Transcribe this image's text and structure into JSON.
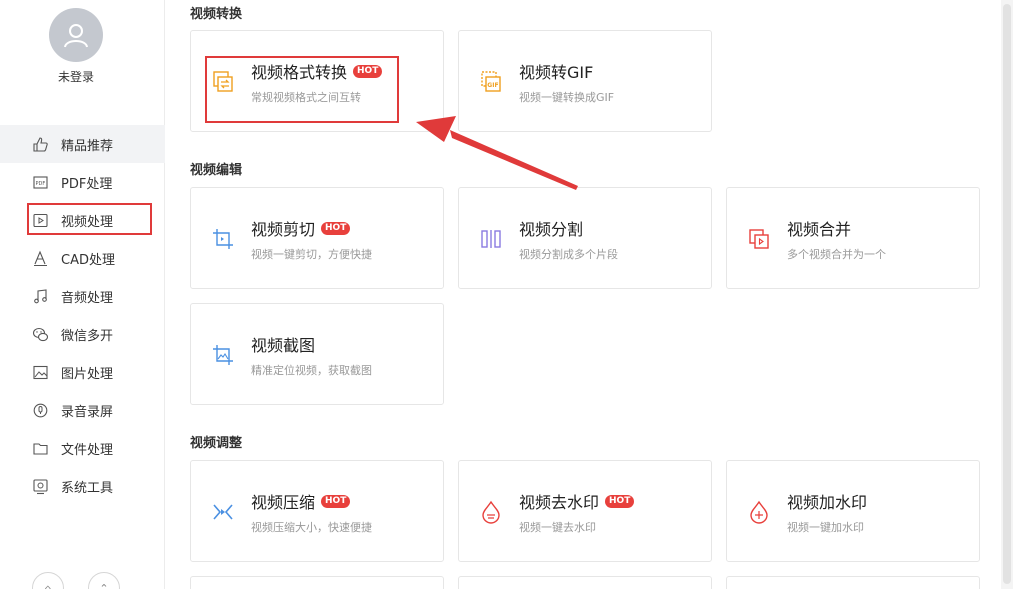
{
  "user": {
    "name": "未登录"
  },
  "sidebar": {
    "items": [
      {
        "label": "精品推荐",
        "icon": "thumbs-up-icon"
      },
      {
        "label": "PDF处理",
        "icon": "pdf-icon"
      },
      {
        "label": "视频处理",
        "icon": "video-icon"
      },
      {
        "label": "CAD处理",
        "icon": "cad-icon"
      },
      {
        "label": "音频处理",
        "icon": "music-note-icon"
      },
      {
        "label": "微信多开",
        "icon": "wechat-icon"
      },
      {
        "label": "图片处理",
        "icon": "image-icon"
      },
      {
        "label": "录音录屏",
        "icon": "record-icon"
      },
      {
        "label": "文件处理",
        "icon": "folder-icon"
      },
      {
        "label": "系统工具",
        "icon": "system-tool-icon"
      }
    ],
    "active_index": 0,
    "highlighted_index": 2
  },
  "sections": [
    {
      "title": "视频转换",
      "cards": [
        {
          "title": "视频格式转换",
          "desc": "常规视频格式之间互转",
          "hot": "HOT",
          "icon": "format-convert-icon"
        },
        {
          "title": "视频转GIF",
          "desc": "视频一键转换成GIF",
          "icon": "gif-icon"
        }
      ]
    },
    {
      "title": "视频编辑",
      "cards": [
        {
          "title": "视频剪切",
          "desc": "视频一键剪切，方便快捷",
          "hot": "HOT",
          "icon": "crop-icon"
        },
        {
          "title": "视频分割",
          "desc": "视频分割成多个片段",
          "icon": "split-icon"
        },
        {
          "title": "视频合并",
          "desc": "多个视频合并为一个",
          "icon": "merge-icon"
        },
        {
          "title": "视频截图",
          "desc": "精准定位视频，获取截图",
          "icon": "screenshot-icon"
        }
      ]
    },
    {
      "title": "视频调整",
      "cards": [
        {
          "title": "视频压缩",
          "desc": "视频压缩大小，快速便捷",
          "hot": "HOT",
          "icon": "compress-icon"
        },
        {
          "title": "视频去水印",
          "desc": "视频一键去水印",
          "hot": "HOT",
          "icon": "remove-watermark-icon"
        },
        {
          "title": "视频加水印",
          "desc": "视频一键加水印",
          "icon": "add-watermark-icon"
        }
      ]
    }
  ],
  "colors": {
    "highlight": "#e03a3a",
    "hot_badge": "#e8403c",
    "accent_blue": "#4a90e2",
    "accent_orange": "#f0a020",
    "accent_purple": "#8a7be0"
  }
}
